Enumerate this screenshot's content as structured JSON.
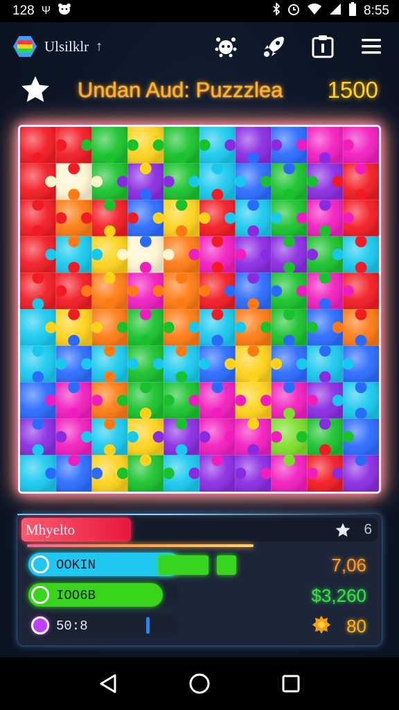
{
  "status_bar": {
    "left_text": "128",
    "icons_left": [
      "emblem-icon",
      "bear-icon"
    ],
    "icons_right": [
      "bluetooth-icon",
      "alarm-icon",
      "wifi-icon",
      "signal-icon",
      "battery-icon"
    ],
    "time": "8:55"
  },
  "header": {
    "app_name": "Ulsilklr",
    "arrow": "↑",
    "actions": [
      "splat-icon",
      "rocket-icon",
      "info-icon",
      "menu-icon"
    ]
  },
  "game": {
    "title": "Undan Aud: Puzzzlea",
    "score": "1500"
  },
  "board": {
    "grid": "10x10",
    "palette": {
      "R": "#f21b24",
      "O": "#ff7a12",
      "Y": "#ffd21a",
      "G": "#18c22c",
      "L": "#7ddf2a",
      "C": "#18c9ee",
      "B": "#2a6bff",
      "P": "#8a2be2",
      "M": "#f21dbf",
      "W": "#fff6d0"
    },
    "rows": [
      "RRGYGCPBMM",
      "RWGPGCBGPR",
      "RORBYRCGMR",
      "RCYWOMPPGC",
      "RROMORBGMR",
      "CYOGOCOGBO",
      "CBCGCBYBCB",
      "BMOGGMYMPC",
      "PMCYPMMLGB",
      "CBYGCPPMRP"
    ]
  },
  "panel": {
    "level_label": "Mhyelto",
    "level_fill": 0.3,
    "star_count": "6",
    "progress": 0.62,
    "stats": [
      {
        "label": "OOKIN",
        "value": "7,06",
        "color": "#1fc8f0",
        "value_color": "#ff9a2a",
        "fill": 1.0
      },
      {
        "label": "IOO6B",
        "value": "$3,260",
        "color": "#39d51a",
        "value_color": "#39e04a",
        "fill": 0.88
      },
      {
        "label": "50:8",
        "value": "80",
        "color": "#c040ff",
        "value_color": "#ffb21a",
        "fill": 0.0
      }
    ]
  },
  "navbar": {
    "buttons": [
      "back-icon",
      "home-icon",
      "recents-icon"
    ]
  }
}
